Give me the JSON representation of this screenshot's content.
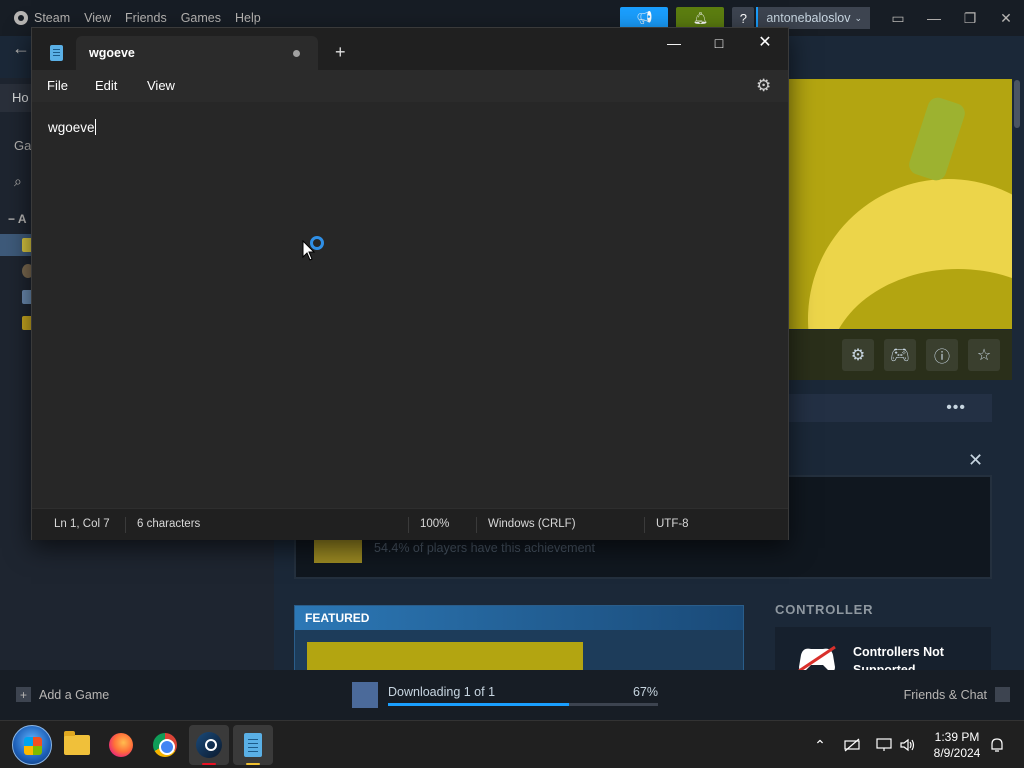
{
  "steam": {
    "menu": [
      "Steam",
      "View",
      "Friends",
      "Games",
      "Help"
    ],
    "account_name": "antonebaloslov",
    "help_label": "?",
    "sidebar": {
      "home_label": "Ho",
      "games_label": "Ga",
      "all_label": "A"
    },
    "achievement_text": "54.4% of players have this achievement",
    "featured_label": "FEATURED",
    "controller_title": "CONTROLLER",
    "controller_text": "Controllers Not Supported",
    "add_game_label": "Add a Game",
    "download_text": "Downloading 1 of 1",
    "download_percent_label": "67%",
    "download_fraction": 0.67,
    "friends_label": "Friends & Chat",
    "more_label": "•••"
  },
  "notepad": {
    "tab_title": "wgoeve",
    "menu": {
      "file": "File",
      "edit": "Edit",
      "view": "View"
    },
    "content": "wgoeve",
    "status": {
      "position": "Ln 1, Col 7",
      "characters": "6 characters",
      "zoom": "100%",
      "line_ending": "Windows (CRLF)",
      "encoding": "UTF-8"
    }
  },
  "taskbar": {
    "apps": [
      "start-orb",
      "file-explorer",
      "firefox",
      "chrome",
      "steam",
      "notepad"
    ],
    "clock_time": "1:39 PM",
    "clock_date": "8/9/2024"
  },
  "colors": {
    "steam_bg": "#1b2838",
    "steam_accent": "#1a9fff",
    "notify_green": "#5c7e10",
    "notepad_bg": "#272727",
    "hero_yellow": "#b3a511"
  }
}
